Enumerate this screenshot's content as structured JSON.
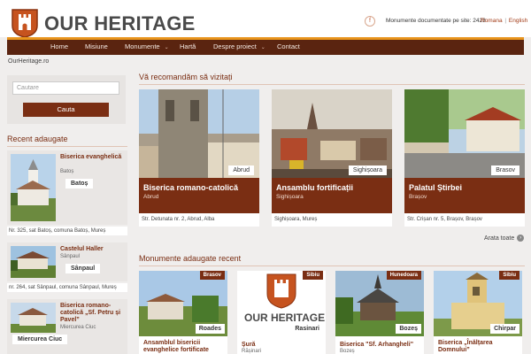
{
  "header": {
    "brand": "OUR HERITAGE",
    "facebook_icon": "facebook-icon",
    "docs_text": "Monumente documentate pe site: 2423",
    "lang_ro": "Romana",
    "lang_sep": "|",
    "lang_en": "English"
  },
  "nav": {
    "items": [
      "Home",
      "Misiune",
      "Monumente",
      "Hartă",
      "Despre proiect",
      "Contact"
    ],
    "dropdown_icon": "chevron-down-icon"
  },
  "site_url": "OurHeritage.ro",
  "search": {
    "placeholder": "Cautare",
    "button": "Cauta"
  },
  "recent": {
    "title": "Recent adaugate",
    "items": [
      {
        "name": "Biserica evanghelică",
        "loc": "Batoș",
        "tag": "Batoș",
        "addr": "Nr. 325, sat Batoș, comuna Batoș, Mureș"
      },
      {
        "name": "Castelul Haller",
        "loc": "Sânpaul",
        "tag": "Sânpaul",
        "addr": "nr. 264, sat Sânpaul, comuna Sânpaul, Mureș"
      },
      {
        "name": "Biserica romano-catolică „Sf. Petru și Pavel”",
        "loc": "Miercurea Ciuc",
        "tag": "Miercurea Ciuc"
      }
    ]
  },
  "recommend": {
    "title": "Vă recomandăm să vizitați",
    "items": [
      {
        "title": "Biserica romano-catolică",
        "sub": "Abrud",
        "tag": "Abrud",
        "addr": "Str. Detunata nr. 2, Abrud, Alba"
      },
      {
        "title": "Ansamblu fortificații",
        "sub": "Sighișoara",
        "tag": "Sighișoara",
        "addr": "Sighișoara, Mureș"
      },
      {
        "title": "Palatul Știrbei",
        "sub": "Brașov",
        "tag": "Brasov",
        "addr": "Str. Crișan nr. 5, Brașov, Brașov"
      }
    ],
    "more": "Arata toate"
  },
  "monuments": {
    "title": "Monumente adaugate recent",
    "items": [
      {
        "county": "Brasov",
        "tag": "Roades",
        "title": "Ansamblul bisericii evanghelice fortificate",
        "sub": ""
      },
      {
        "county": "Sibiu",
        "tag": "Rasinari",
        "title": "Șură",
        "sub": "Rășinari"
      },
      {
        "county": "Hunedoara",
        "tag": "Bozeș",
        "title": "Biserica \"Sf. Arhangheli\"",
        "sub": "Bozeș"
      },
      {
        "county": "Sibiu",
        "tag": "Chirpar",
        "title": "Biserica „Înălțarea Domnului”",
        "sub": ""
      }
    ]
  },
  "colors": {
    "primary": "#7a2e13",
    "nav": "#5a2410",
    "accent": "#e8941d"
  }
}
